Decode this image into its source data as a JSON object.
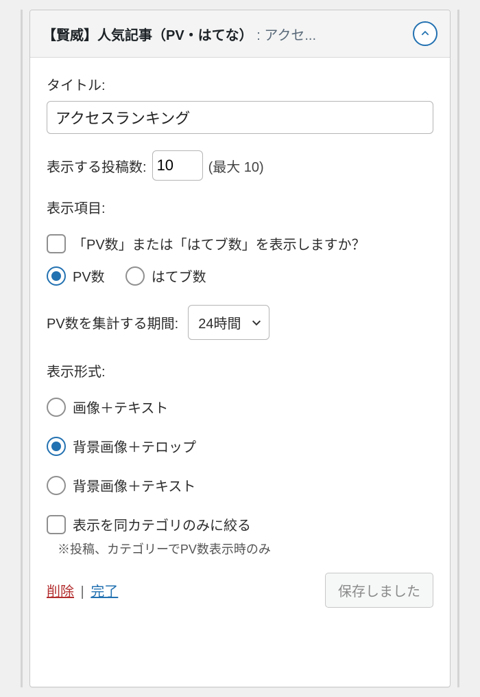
{
  "header": {
    "title": "【賢威】人気記事（PV・はてな）",
    "title_sep": " : ",
    "title_suffix": "アクセ..."
  },
  "title_field": {
    "label": "タイトル:",
    "value": "アクセスランキング"
  },
  "post_count": {
    "label": "表示する投稿数:",
    "value": "10",
    "hint": "(最大 10)"
  },
  "display_items": {
    "label": "表示項目:",
    "show_pv_label": "「PV数」または「はてブ数」を表示しますか？",
    "pv_label": "PV数",
    "hatebu_label": "はてブ数"
  },
  "period": {
    "label": "PV数を集計する期間:",
    "value": "24時間"
  },
  "format": {
    "label": "表示形式:",
    "opt1": "画像＋テキスト",
    "opt2": "背景画像＋テロップ",
    "opt3": "背景画像＋テキスト"
  },
  "same_category": {
    "label": "表示を同カテゴリのみに絞る",
    "hint": "※投稿、カテゴリーでPV数表示時のみ"
  },
  "footer": {
    "delete": "削除",
    "sep": " | ",
    "done": "完了",
    "saved": "保存しました"
  }
}
